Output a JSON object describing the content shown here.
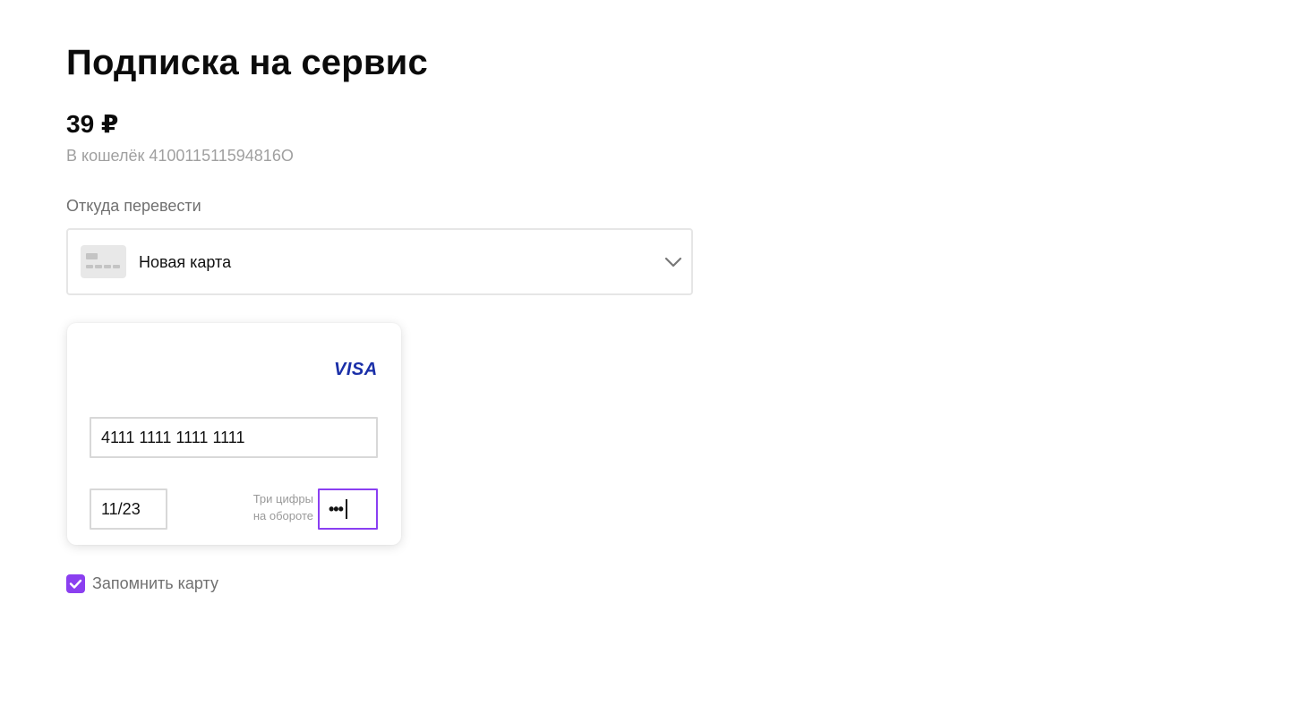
{
  "page": {
    "title": "Подписка на сервис",
    "amount": "39 ₽",
    "wallet_text": "В кошелёк 410011511594816О"
  },
  "payment_source": {
    "label": "Откуда перевести",
    "selected": "Новая карта",
    "icon": "credit-card-icon"
  },
  "card_form": {
    "brand": "VISA",
    "brand_color": "#1a2fa8",
    "card_number": "4111 1111 1111 1111",
    "expiry": "11/23",
    "cvc_hint_line1": "Три цифры",
    "cvc_hint_line2": "на обороте",
    "cvc_masked": "•••",
    "cvc_focus_color": "#8a3ff2"
  },
  "remember_card": {
    "label": "Запомнить карту",
    "checked": true,
    "color": "#8b3ff0"
  }
}
